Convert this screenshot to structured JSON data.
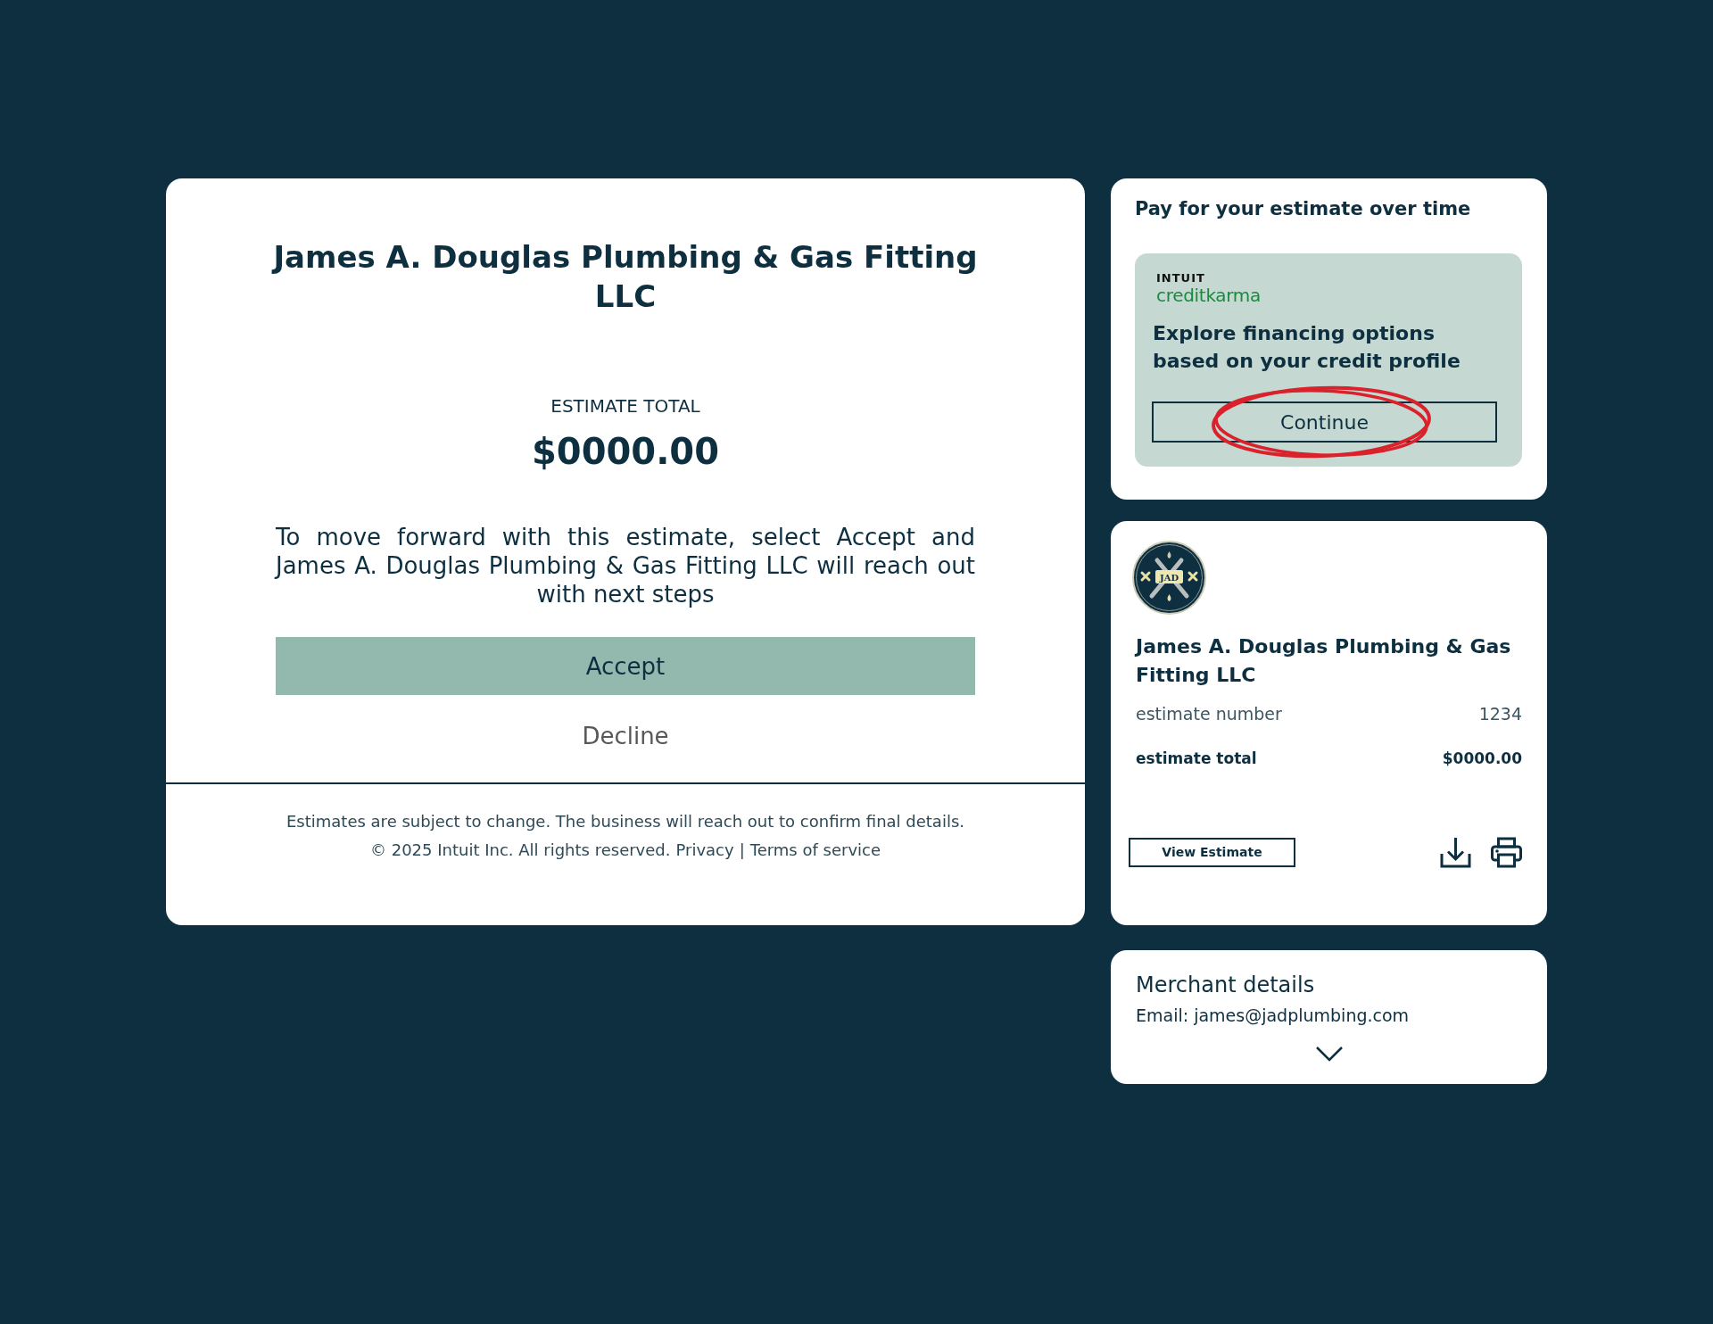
{
  "estimate": {
    "business_name": "James A. Douglas Plumbing & Gas Fitting LLC",
    "total_label": "ESTIMATE TOTAL",
    "total": "$0000.00",
    "message": "To move forward with this estimate, select Accept and James A. Douglas Plumbing & Gas Fitting LLC will reach out with next steps",
    "accept_button": "Accept",
    "decline_button": "Decline"
  },
  "footer": {
    "disclaimer": "Estimates are subject to change. The business will reach out to confirm final details.",
    "copyright": "© 2025 Intuit Inc. All rights reserved.",
    "links": [
      "Privacy",
      "Terms of service"
    ],
    "separator": "|"
  },
  "financing": {
    "title": "Pay for your estimate over time",
    "partner_logo": {
      "overline": "INTUIT",
      "wordmark": "creditkarma"
    },
    "headline": "Explore financing options based on your credit profile",
    "button": {
      "label": "Continue",
      "circled": true
    }
  },
  "summary": {
    "logo_text": "JAD",
    "business_name": "James A. Douglas Plumbing & Gas Fitting LLC",
    "rows": [
      {
        "label": "estimate number",
        "value": "1234",
        "emphasis": false
      },
      {
        "label": "estimate total",
        "value": "$0000.00",
        "emphasis": true
      }
    ],
    "view_button": "View Estimate"
  },
  "merchant": {
    "title": "Merchant details",
    "email": "Email: james@jadplumbing.com",
    "expanded": false
  }
}
